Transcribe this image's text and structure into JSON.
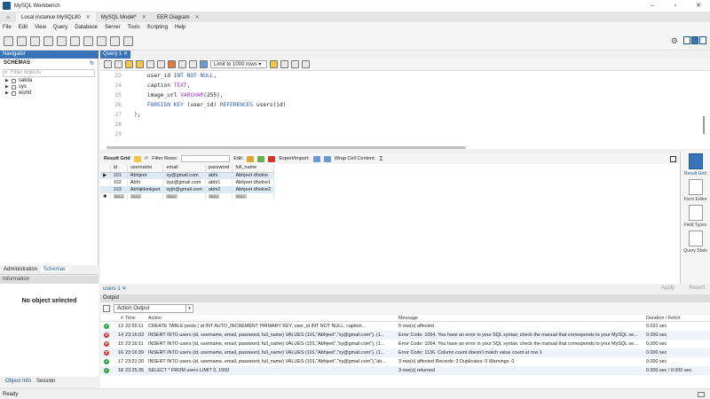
{
  "window": {
    "title": "MySQL Workbench",
    "controls": [
      "–",
      "▫",
      "✕"
    ]
  },
  "tabs": [
    {
      "label": "Local instance MySQL80"
    },
    {
      "label": "MySQL Model*"
    },
    {
      "label": "EER Diagram"
    }
  ],
  "menu": [
    "File",
    "Edit",
    "View",
    "Query",
    "Database",
    "Server",
    "Tools",
    "Scripting",
    "Help"
  ],
  "navigator": {
    "title": "Navigator",
    "schemas_label": "SCHEMAS",
    "filter_placeholder": "Filter objects",
    "schemas": [
      "sakila",
      "sys",
      "world"
    ],
    "tabs": [
      "Administration",
      "Schemas"
    ],
    "info_title": "Information",
    "no_object": "No object selected",
    "bottom_tabs": [
      "Object Info",
      "Session"
    ]
  },
  "query_tab": {
    "label": "Query 1"
  },
  "sql_toolbar": {
    "limit": "Limit to 1000 rows"
  },
  "editor": {
    "lines": [
      {
        "n": "23",
        "parts": [
          [
            "",
            "    user_id "
          ],
          [
            "kw",
            "INT NOT NULL"
          ],
          [
            "",
            ","
          ]
        ]
      },
      {
        "n": "24",
        "parts": [
          [
            "",
            "    caption "
          ],
          [
            "ty",
            "TEXT"
          ],
          [
            "",
            ","
          ]
        ]
      },
      {
        "n": "25",
        "parts": [
          [
            "",
            "    image_url "
          ],
          [
            "ty",
            "VARCHAR"
          ],
          [
            "",
            "(255),"
          ]
        ]
      },
      {
        "n": "26",
        "parts": [
          [
            "",
            "    "
          ],
          [
            "kw",
            "FOREIGN KEY"
          ],
          [
            "",
            " (user_id) "
          ],
          [
            "kw",
            "REFERENCES"
          ],
          [
            "",
            " users(id)"
          ]
        ]
      },
      {
        "n": "27",
        "parts": [
          [
            "",
            ");"
          ]
        ]
      },
      {
        "n": "28",
        "parts": []
      },
      {
        "n": "29",
        "parts": []
      }
    ]
  },
  "grid_toolbar": {
    "result_grid": "Result Grid",
    "filter_rows": "Filter Rows:",
    "edit": "Edit:",
    "export": "Export/Import:",
    "wrap": "Wrap Cell Content:"
  },
  "result": {
    "columns": [
      "id",
      "username",
      "email",
      "password",
      "full_name"
    ],
    "rows": [
      [
        "101",
        "Abhjeet",
        "xy@gmail.com",
        "abhi",
        "Abhjeet dholne"
      ],
      [
        "102",
        "Abhi",
        "xyz@gmail.com",
        "abhi1",
        "Abhjeet dholne1"
      ],
      [
        "103",
        "Abhijitkinkjeet",
        "xyjh@gmail.com",
        "abhi2",
        "Abhjeet dholne2"
      ]
    ],
    "null_label": "NULL"
  },
  "side_panel": [
    "Result Grid",
    "Form Editor",
    "Field Types",
    "Query Stats"
  ],
  "result_tab": {
    "label": "users 1",
    "apply": "Apply",
    "revert": "Revert"
  },
  "output": {
    "title": "Output",
    "select": "Action Output",
    "headers": {
      "n": "#",
      "time": "Time",
      "action": "Action",
      "message": "Message",
      "duration": "Duration / Fetch"
    },
    "rows": [
      {
        "status": "ok",
        "n": "13",
        "time": "22:55:11",
        "action": "CREATE TABLE posts (     id INT AUTO_INCREMENT PRIMARY KEY,     user_id INT NOT NULL,     caption...",
        "message": "0 row(s) affected",
        "duration": "0.031 sec"
      },
      {
        "status": "err",
        "n": "14",
        "time": "23:16:03",
        "action": "INSERT INTO users (id, username, email, password, full_name) VALUES (101,\"Abhjeet\",\"xy@gmail.com\"), (1...",
        "message": "Error Code: 1064. You have an error in your SQL syntax; check the manual that corresponds to your MySQL se...",
        "duration": "0.000 sec"
      },
      {
        "status": "err",
        "n": "15",
        "time": "23:16:11",
        "action": "INSERT INTO users (id, username, email, password, full_name) VALUES (101,\"Abhjeet\",\"xy@gmail.com\"), (1...",
        "message": "Error Code: 1064. You have an error in your SQL syntax; check the manual that corresponds to your MySQL se...",
        "duration": "0.000 sec"
      },
      {
        "status": "err",
        "n": "16",
        "time": "23:16:39",
        "action": "INSERT INTO users (id, username, email, password, full_name) VALUES (101,\"Abhjeet\",\"xy@gmail.com\"), (1...",
        "message": "Error Code: 1136. Column count doesn't match value count at row 1",
        "duration": "0.000 sec"
      },
      {
        "status": "ok",
        "n": "17",
        "time": "23:21:20",
        "action": "INSERT INTO users (id, username, email, password, full_name) VALUES (101,\"Abhjeet\",\"xy@gmail.com\"),\"ab...",
        "message": "3 row(s) affected Records: 3  Duplicates: 0  Warnings: 0",
        "duration": "0.000 sec"
      },
      {
        "status": "ok",
        "n": "18",
        "time": "23:25:35",
        "action": "SELECT * FROM users LIMIT 0, 1000",
        "message": "3 row(s) returned",
        "duration": "0.000 sec / 0.000 sec"
      }
    ]
  },
  "status_bar": "Ready",
  "colors": {
    "accent": "#3b73b9",
    "ok": "#2e9e3e",
    "error": "#d0342c"
  }
}
